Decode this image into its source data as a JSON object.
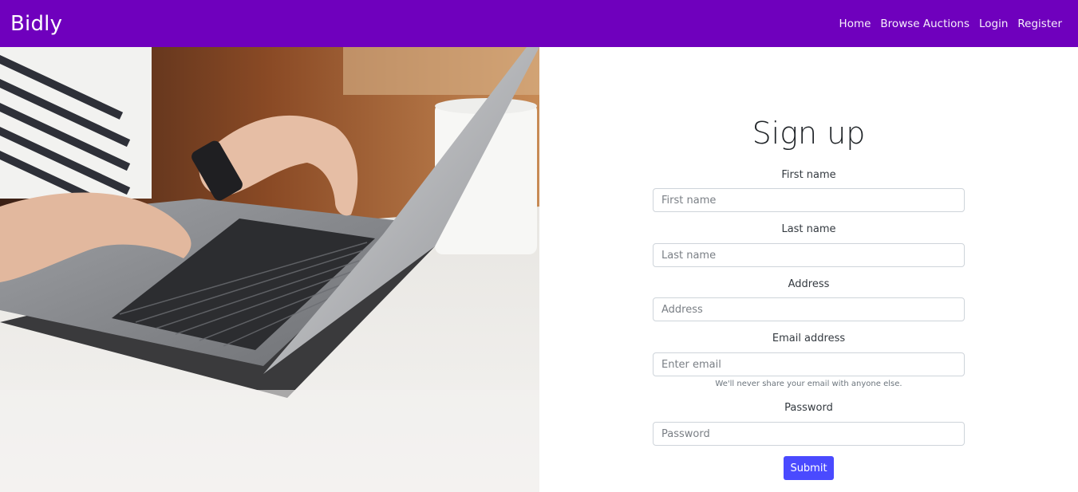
{
  "navbar": {
    "brand": "Bidly",
    "links": [
      "Home",
      "Browse Auctions",
      "Login",
      "Register"
    ]
  },
  "form": {
    "title": "Sign up",
    "fields": [
      {
        "label": "First name",
        "placeholder": "First name"
      },
      {
        "label": "Last name",
        "placeholder": "Last name"
      },
      {
        "label": "Address",
        "placeholder": "Address"
      },
      {
        "label": "Email address",
        "placeholder": "Enter email",
        "help": "We'll never share your email with anyone else."
      },
      {
        "label": "Password",
        "placeholder": "Password"
      }
    ],
    "submit_label": "Submit"
  },
  "colors": {
    "navbar": "#6f00bd",
    "submit": "#4a4aff"
  }
}
